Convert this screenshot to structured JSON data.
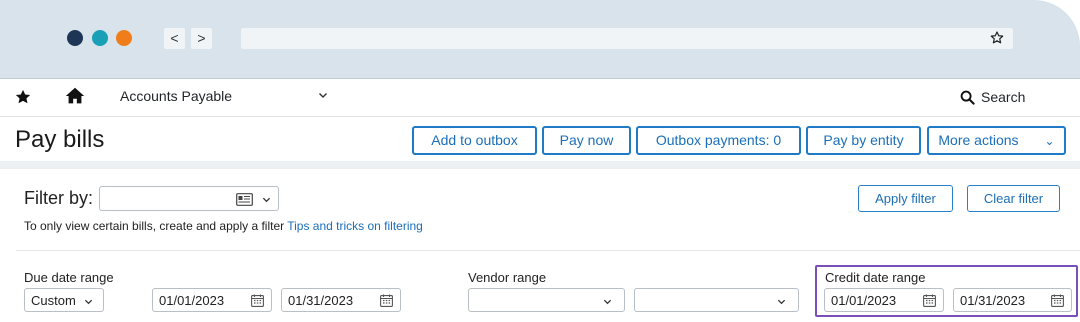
{
  "browser": {
    "back_label": "<",
    "forward_label": ">"
  },
  "topbar": {
    "module_label": "Accounts Payable",
    "search_label": "Search"
  },
  "page": {
    "title": "Pay bills"
  },
  "actions": {
    "add_to_outbox": "Add to outbox",
    "pay_now": "Pay now",
    "outbox_payments": "Outbox payments: 0",
    "pay_by_entity": "Pay by entity",
    "more_actions": "More actions"
  },
  "filter": {
    "label": "Filter by:",
    "value": "",
    "apply_label": "Apply filter",
    "clear_label": "Clear filter",
    "hint_text": "To only view certain bills, create and apply a filter ",
    "hint_link": "Tips and tricks on filtering"
  },
  "due_date_range": {
    "label": "Due date range",
    "preset": "Custom",
    "from": "01/01/2023",
    "to": "01/31/2023"
  },
  "vendor_range": {
    "label": "Vendor range",
    "from": "",
    "to": ""
  },
  "credit_date_range": {
    "label": "Credit date range",
    "from": "01/01/2023",
    "to": "01/31/2023"
  },
  "colors": {
    "accent": "#1f7ac7",
    "highlight": "#7b4fb8"
  }
}
